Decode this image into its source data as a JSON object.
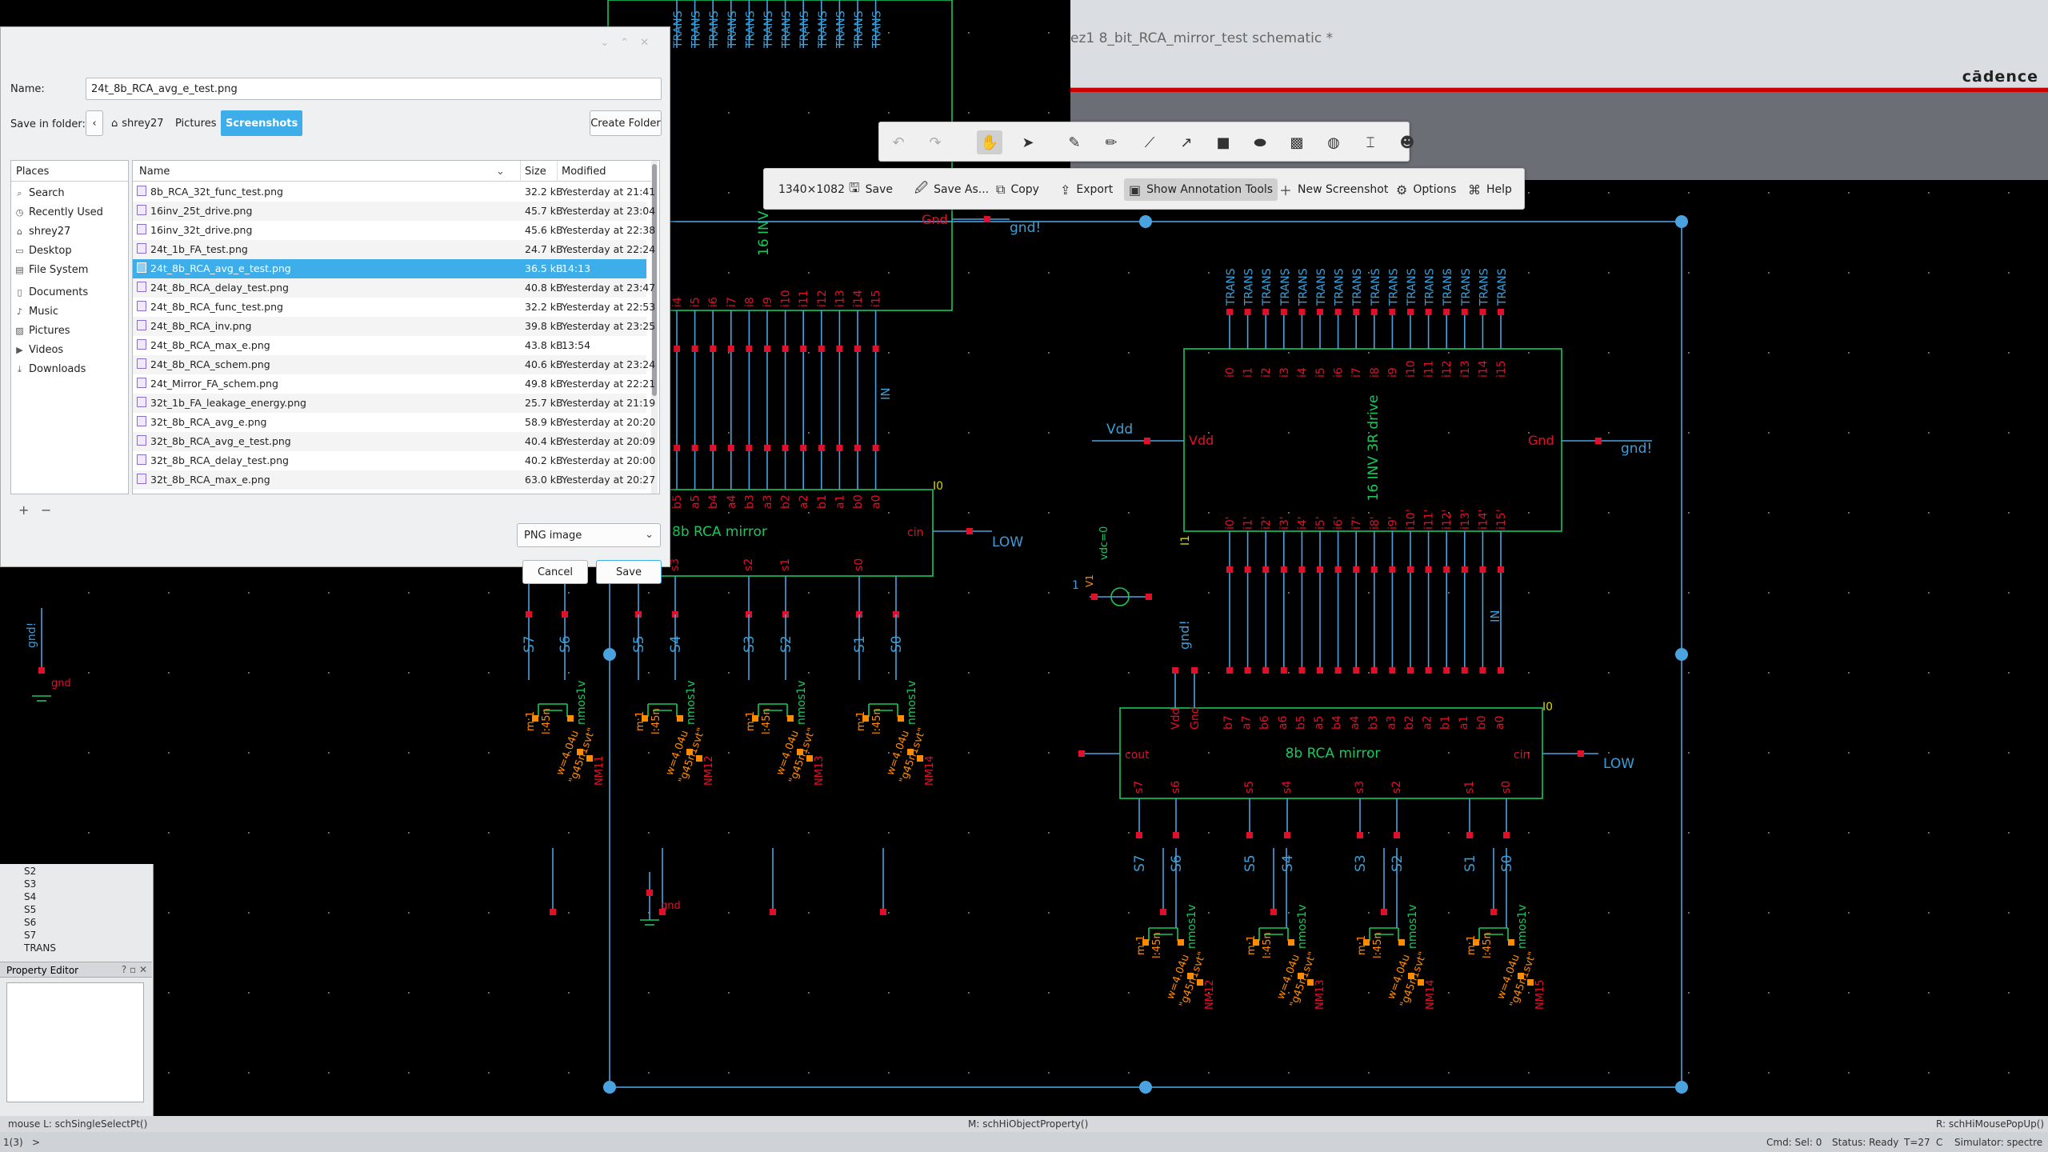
{
  "window": {
    "title": "ez1 8_bit_RCA_mirror_test schematic *",
    "brand": "cādence"
  },
  "dialog": {
    "name_label": "Name:",
    "name_value": "24t_8b_RCA_avg_e_test.png",
    "folder_label": "Save in folder:",
    "breadcrumbs": [
      "shrey27",
      "Pictures",
      "Screenshots"
    ],
    "create_folder": "Create Folder",
    "places_header": "Places",
    "places": [
      {
        "label": "Search",
        "icon": "search-icon"
      },
      {
        "label": "Recently Used",
        "icon": "clock-icon"
      },
      {
        "label": "shrey27",
        "icon": "home-icon"
      },
      {
        "label": "Desktop",
        "icon": "desktop-icon"
      },
      {
        "label": "File System",
        "icon": "drive-icon"
      },
      {
        "label": "Documents",
        "icon": "document-icon"
      },
      {
        "label": "Music",
        "icon": "music-icon"
      },
      {
        "label": "Pictures",
        "icon": "picture-icon"
      },
      {
        "label": "Videos",
        "icon": "video-icon"
      },
      {
        "label": "Downloads",
        "icon": "download-icon"
      }
    ],
    "columns": {
      "name": "Name",
      "size": "Size",
      "modified": "Modified"
    },
    "files": [
      {
        "name": "8b_RCA_32t_func_test.png",
        "size": "32.2 kB",
        "modified": "Yesterday at 21:41"
      },
      {
        "name": "16inv_25t_drive.png",
        "size": "45.7 kB",
        "modified": "Yesterday at 23:04"
      },
      {
        "name": "16inv_32t_drive.png",
        "size": "45.6 kB",
        "modified": "Yesterday at 22:38"
      },
      {
        "name": "24t_1b_FA_test.png",
        "size": "24.7 kB",
        "modified": "Yesterday at 22:24"
      },
      {
        "name": "24t_8b_RCA_avg_e_test.png",
        "size": "36.5 kB",
        "modified": "14:13",
        "selected": true
      },
      {
        "name": "24t_8b_RCA_delay_test.png",
        "size": "40.8 kB",
        "modified": "Yesterday at 23:47"
      },
      {
        "name": "24t_8b_RCA_func_test.png",
        "size": "32.2 kB",
        "modified": "Yesterday at 22:53"
      },
      {
        "name": "24t_8b_RCA_inv.png",
        "size": "39.8 kB",
        "modified": "Yesterday at 23:25"
      },
      {
        "name": "24t_8b_RCA_max_e.png",
        "size": "43.8 kB",
        "modified": "13:54"
      },
      {
        "name": "24t_8b_RCA_schem.png",
        "size": "40.6 kB",
        "modified": "Yesterday at 23:24"
      },
      {
        "name": "24t_Mirror_FA_schem.png",
        "size": "49.8 kB",
        "modified": "Yesterday at 22:21"
      },
      {
        "name": "32t_1b_FA_leakage_energy.png",
        "size": "25.7 kB",
        "modified": "Yesterday at 21:19"
      },
      {
        "name": "32t_8b_RCA_avg_e.png",
        "size": "58.9 kB",
        "modified": "Yesterday at 20:20"
      },
      {
        "name": "32t_8b_RCA_avg_e_test.png",
        "size": "40.4 kB",
        "modified": "Yesterday at 20:09"
      },
      {
        "name": "32t_8b_RCA_delay_test.png",
        "size": "40.2 kB",
        "modified": "Yesterday at 20:00"
      },
      {
        "name": "32t_8b_RCA_max_e.png",
        "size": "63.0 kB",
        "modified": "Yesterday at 20:27"
      }
    ],
    "add": "+",
    "remove": "−",
    "filetype": "PNG image",
    "cancel": "Cancel",
    "save": "Save"
  },
  "spectacle": {
    "size": "1340×1082",
    "save": "Save",
    "save_as": "Save As...",
    "copy": "Copy",
    "export": "Export",
    "show_annotation": "Show Annotation Tools",
    "new_screenshot": "New Screenshot",
    "options": "Options",
    "help": "Help"
  },
  "annotation_tools": [
    "undo-icon",
    "redo-icon",
    "pan-icon",
    "select-icon",
    "highlighter-icon",
    "pen-icon",
    "line-icon",
    "arrow-icon",
    "rectangle-icon",
    "ellipse-icon",
    "pixelate-icon",
    "blur-icon",
    "text-icon",
    "sticker-icon"
  ],
  "left_tree": [
    "S2",
    "S3",
    "S4",
    "S5",
    "S6",
    "S7",
    "TRANS"
  ],
  "property_editor": "Property Editor",
  "status": {
    "mouse_l": "mouse L: schSingleSelectPt()",
    "middle": "M: schHiObjectProperty()",
    "right": "R: schHiMousePopUp()",
    "line_no": "1(3)",
    "prompt": ">",
    "cmd": "Cmd: Sel: 0",
    "ready": "Status: Ready",
    "temp": "T=27",
    "c": "C",
    "sim": "Simulator: spectre"
  },
  "schematic": {
    "right_block": {
      "label": "16 INV 3R drive",
      "inst": "I1",
      "vdd_pin": "Vdd",
      "gnd_pin": "Gnd",
      "vdd_net": "Vdd",
      "gnd_net": "gnd!",
      "in_net": "IN",
      "pins_top": [
        "i0",
        "i1",
        "i2",
        "i3",
        "i4",
        "i5",
        "i6",
        "i7",
        "i8",
        "i9",
        "i10",
        "i11",
        "i12",
        "i13",
        "i14",
        "i15"
      ],
      "pins_bot": [
        "i0'",
        "i1'",
        "i2'",
        "i3'",
        "i4'",
        "i5'",
        "i6'",
        "i7'",
        "i8'",
        "i9'",
        "i10'",
        "i11'",
        "i12'",
        "i13'",
        "i14'",
        "i15'"
      ],
      "trans": "TRANS"
    },
    "mirror_right": {
      "label": "8b RCA mirror",
      "inst": "I0",
      "vdd": "Vdd",
      "gnd": "Gnd",
      "cout": "cout",
      "cin": "cin",
      "low": "LOW",
      "inputs": [
        "b7",
        "a7",
        "b6",
        "a6",
        "b5",
        "a5",
        "b4",
        "a4",
        "b3",
        "a3",
        "b2",
        "a2",
        "b1",
        "a1",
        "b0",
        "a0"
      ],
      "sums": [
        "s7",
        "s6",
        "s5",
        "s4",
        "s3",
        "s2",
        "s1",
        "s0"
      ],
      "sum_nets": [
        "S7",
        "S6",
        "S5",
        "S4",
        "S3",
        "S2",
        "S1",
        "S0"
      ],
      "gnd_label": "gnd!"
    },
    "mirror_left": {
      "label": "8b RCA mirror",
      "inst": "I0",
      "cin": "cin",
      "low": "LOW",
      "gnd_net": "gnd!",
      "block_label": "16 INV",
      "in_net": "IN",
      "pins_top": [
        "i4",
        "i5",
        "i6",
        "i7",
        "i8",
        "i9",
        "i10",
        "i11",
        "i12",
        "i13",
        "i14",
        "i15"
      ],
      "inputs": [
        "b5",
        "a5",
        "b4",
        "a4",
        "b3",
        "a3",
        "b2",
        "a2",
        "b1",
        "a1",
        "b0",
        "a0"
      ],
      "sums": [
        "s4",
        "s3",
        "s2",
        "s1",
        "s0"
      ],
      "sum_nets": [
        "S7",
        "S6",
        "S5",
        "S4",
        "S3",
        "S2",
        "S1",
        "S0"
      ],
      "gnd_pin": "Gnd",
      "gnd": "gnd"
    },
    "vsource": {
      "label": "vdc=0",
      "pin": "V1",
      "one": "1"
    },
    "transistor": {
      "model": "nmos1v",
      "w": "w=4.04u",
      "l": "l:45n",
      "m": "m:1",
      "g": "\"g45n1svt\"",
      "names": [
        "NM11",
        "NM12",
        "NM13",
        "NM14",
        "NM15"
      ]
    }
  },
  "colors": {
    "grid": "#3a3a3a",
    "wire": "#4aa3df",
    "pin": "#e0102b",
    "text": "#3a9fd8",
    "block": "#19c85a",
    "inst": "#d7d700",
    "highlight": "#ff8c00"
  }
}
